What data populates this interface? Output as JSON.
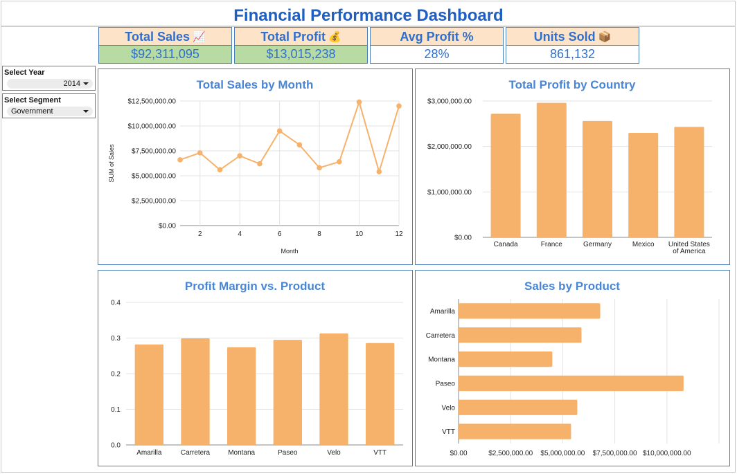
{
  "dashboard": {
    "title": "Financial Performance Dashboard"
  },
  "kpis": [
    {
      "label": "Total Sales",
      "icon": "chart-increasing-icon",
      "value": "$92,311,095",
      "highlight": "#b7dba2"
    },
    {
      "label": "Total Profit",
      "icon": "money-bag-icon",
      "value": "$13,015,238",
      "highlight": "#b7dba2"
    },
    {
      "label": "Avg Profit %",
      "icon": "",
      "value": "28%",
      "highlight": ""
    },
    {
      "label": "Units Sold",
      "icon": "package-icon",
      "value": "861,132",
      "highlight": ""
    }
  ],
  "filters": {
    "year": {
      "label": "Select Year",
      "value": "2014"
    },
    "segment": {
      "label": "Select Segment",
      "value": "Government"
    }
  },
  "colors": {
    "accent": "#f6b26b",
    "title": "#1f5fc1",
    "chart_title": "#4a86d6",
    "panel_border": "#4a7ebb",
    "kpi_header": "#fde3c8"
  },
  "chart_data": [
    {
      "type": "line",
      "title": "Total Sales by Month",
      "xlabel": "Month",
      "ylabel": "SUM of Sales",
      "x": [
        1,
        2,
        3,
        4,
        5,
        6,
        7,
        8,
        9,
        10,
        11,
        12
      ],
      "values": [
        6600000,
        7300000,
        5600000,
        7000000,
        6200000,
        9500000,
        8100000,
        5800000,
        6400000,
        12400000,
        5400000,
        12000000
      ],
      "xticks": [
        "2",
        "4",
        "6",
        "8",
        "10",
        "12"
      ],
      "yticks": [
        "$0.00",
        "$2,500,000.00",
        "$5,000,000.00",
        "$7,500,000.00",
        "$10,000,000.00",
        "$12,500,000.00"
      ],
      "xlim": [
        1,
        12
      ],
      "ylim": [
        0,
        12500000
      ],
      "grid": true
    },
    {
      "type": "bar",
      "title": "Total Profit by Country",
      "categories": [
        "Canada",
        "France",
        "Germany",
        "Mexico",
        "United States of America"
      ],
      "category_lines": [
        [
          "Canada"
        ],
        [
          "France"
        ],
        [
          "Germany"
        ],
        [
          "Mexico"
        ],
        [
          "United States",
          "of America"
        ]
      ],
      "values": [
        2720000,
        2960000,
        2560000,
        2300000,
        2430000
      ],
      "yticks": [
        "$0.00",
        "$1,000,000.00",
        "$2,000,000.00",
        "$3,000,000.00"
      ],
      "ylim": [
        0,
        3000000
      ],
      "grid": true
    },
    {
      "type": "bar",
      "title": "Profit Margin vs. Product",
      "categories": [
        "Amarilla",
        "Carretera",
        "Montana",
        "Paseo",
        "Velo",
        "VTT"
      ],
      "values": [
        0.282,
        0.299,
        0.274,
        0.295,
        0.313,
        0.286
      ],
      "yticks": [
        "0.0",
        "0.1",
        "0.2",
        "0.3",
        "0.4"
      ],
      "ylim": [
        0,
        0.4
      ],
      "grid": true
    },
    {
      "type": "bar",
      "orientation": "horizontal",
      "title": "Sales by Product",
      "categories": [
        "Amarilla",
        "Carretera",
        "Montana",
        "Paseo",
        "Velo",
        "VTT"
      ],
      "values": [
        6800000,
        5900000,
        4500000,
        10800000,
        5700000,
        5400000
      ],
      "xticks": [
        "$0.00",
        "$2,500,000.00",
        "$5,000,000.00",
        "$7,500,000.00",
        "$10,000,000.00"
      ],
      "xlim": [
        0,
        12500000
      ],
      "grid": true
    }
  ]
}
